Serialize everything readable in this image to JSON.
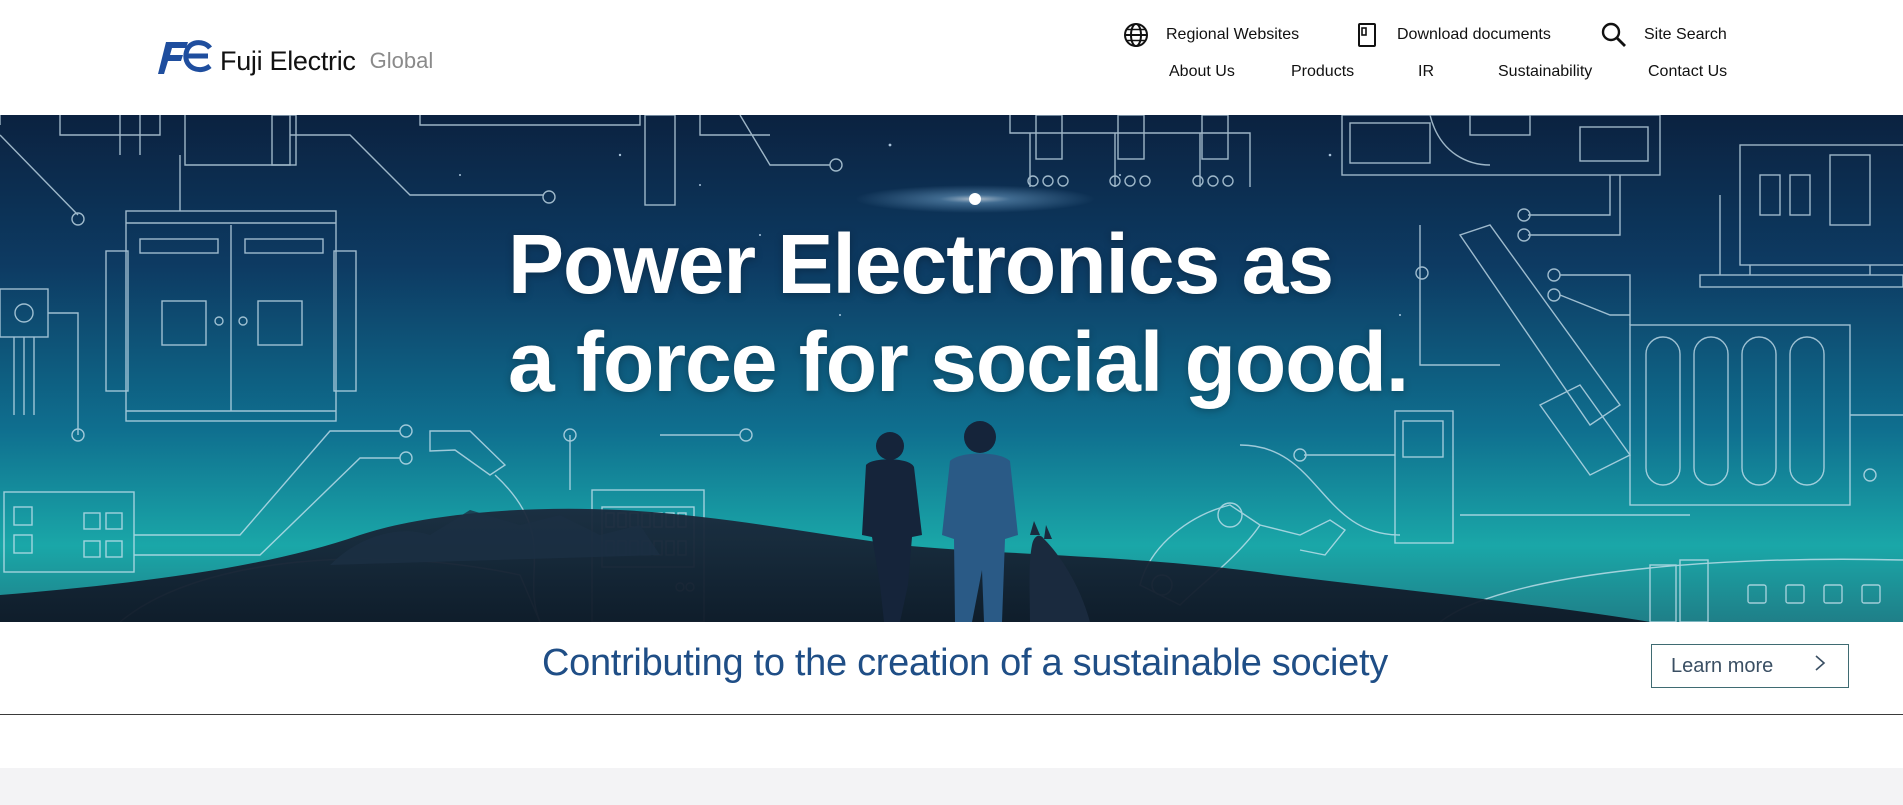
{
  "header": {
    "logo": {
      "mark": "Fe",
      "name": "Fuji Electric",
      "sub": "Global"
    },
    "utility_links": [
      {
        "label": "Regional Websites",
        "icon": "globe-icon"
      },
      {
        "label": "Download documents",
        "icon": "document-icon"
      },
      {
        "label": "Site Search",
        "icon": "search-icon"
      }
    ],
    "nav": [
      "About Us",
      "Products",
      "IR",
      "Sustainability",
      "Contact Us"
    ]
  },
  "hero": {
    "title_line1": "Power Electronics as",
    "title_line2": "a force for social good."
  },
  "band": {
    "tagline": "Contributing to the creation of a sustainable society",
    "learn_more": "Learn more"
  },
  "colors": {
    "brand_blue": "#1f4e86",
    "hero_sky_top": "#0b2240",
    "hero_sky_bottom": "#1aa7a8"
  }
}
